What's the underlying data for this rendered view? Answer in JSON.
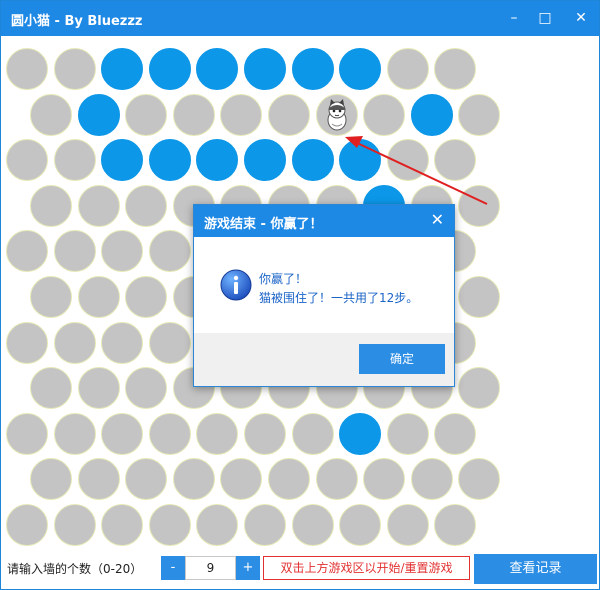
{
  "window": {
    "title": "圆小猫 - By Bluezzz",
    "minimize": "–",
    "maximize": "□",
    "close": "✕"
  },
  "colors": {
    "titlebar": "#1e88e5",
    "wall": "#0c97e8",
    "empty": "#c4c4c4",
    "accent": "#2c8de4",
    "hint_red": "#e23030"
  },
  "board": {
    "rows": [
      "..WWWWWW..",
      ".W....C.W.",
      "..WWWWWW..",
      ".......W..",
      "..........",
      "..........",
      "..........",
      "..........",
      ".......W..",
      "..........",
      ".........."
    ],
    "cat": "cat-sprite"
  },
  "dialog": {
    "title": "游戏结束 - 你赢了！",
    "close": "✕",
    "icon": "info-icon",
    "line1": "你赢了！",
    "line2": "猫被围住了！一共用了12步。",
    "ok_label": "确定"
  },
  "controls": {
    "prompt": "请输入墙的个数（0-20）",
    "minus_label": "-",
    "plus_label": "+",
    "wall_count": "9",
    "hint": "双击上方游戏区以开始/重置游戏",
    "record_label": "查看记录"
  }
}
